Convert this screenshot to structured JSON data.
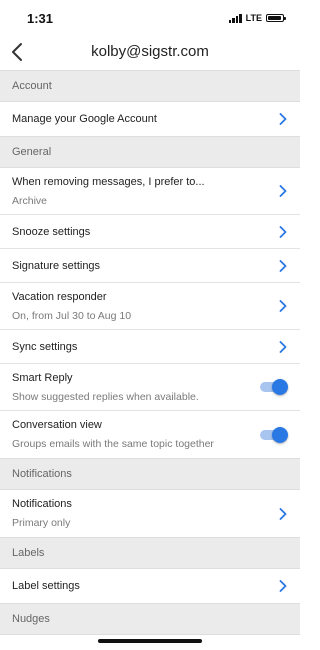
{
  "status_bar": {
    "time": "1:31",
    "network": "LTE"
  },
  "header": {
    "title": "kolby@sigstr.com"
  },
  "colors": {
    "accent": "#2a78e4",
    "section_bg": "#ebebeb",
    "toggle_track": "#a8c5f0"
  },
  "sections": {
    "account": {
      "title": "Account",
      "manage": {
        "label": "Manage your Google Account"
      }
    },
    "general": {
      "title": "General",
      "removing": {
        "label": "When removing messages, I prefer to...",
        "value": "Archive"
      },
      "snooze": {
        "label": "Snooze settings"
      },
      "signature": {
        "label": "Signature settings"
      },
      "vacation": {
        "label": "Vacation responder",
        "value": "On, from Jul 30 to Aug 10"
      },
      "sync": {
        "label": "Sync settings"
      },
      "smart_reply": {
        "label": "Smart Reply",
        "sub": "Show suggested replies when available.",
        "enabled": true
      },
      "conversation": {
        "label": "Conversation view",
        "sub": "Groups emails with the same topic together",
        "enabled": true
      }
    },
    "notifications": {
      "title": "Notifications",
      "notifications": {
        "label": "Notifications",
        "value": "Primary only"
      }
    },
    "labels": {
      "title": "Labels",
      "label_settings": {
        "label": "Label settings"
      }
    },
    "nudges": {
      "title": "Nudges"
    }
  }
}
